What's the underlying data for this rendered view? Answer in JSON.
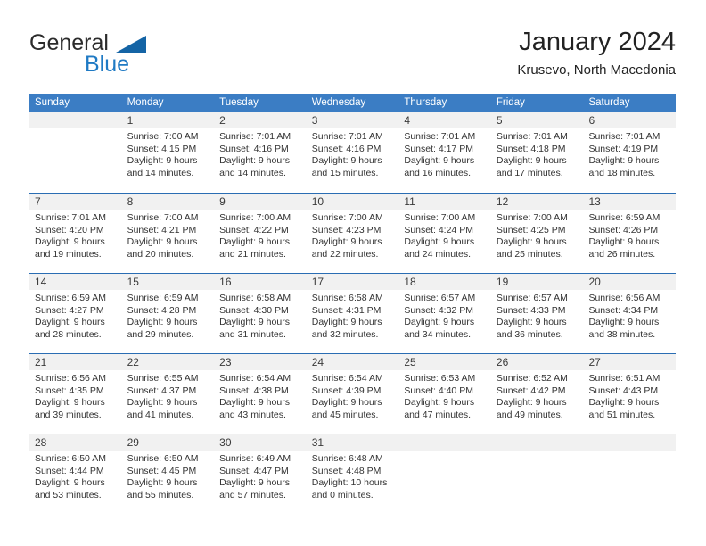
{
  "brand": {
    "name_part1": "General",
    "name_part2": "Blue",
    "triangle_icon": "triangle-icon",
    "color_dark": "#2b2b2b",
    "color_blue": "#1f7ac4"
  },
  "header": {
    "title": "January 2024",
    "subtitle": "Krusevo, North Macedonia"
  },
  "theme": {
    "header_bar_color": "#3b7dc4",
    "row_divider_color": "#2a6db3",
    "day_band_color": "#f1f1f1"
  },
  "weekdays": [
    "Sunday",
    "Monday",
    "Tuesday",
    "Wednesday",
    "Thursday",
    "Friday",
    "Saturday"
  ],
  "weeks": [
    [
      {
        "day": "",
        "sunrise": "",
        "sunset": "",
        "daylight_line1": "",
        "daylight_line2": ""
      },
      {
        "day": "1",
        "sunrise": "Sunrise: 7:00 AM",
        "sunset": "Sunset: 4:15 PM",
        "daylight_line1": "Daylight: 9 hours",
        "daylight_line2": "and 14 minutes."
      },
      {
        "day": "2",
        "sunrise": "Sunrise: 7:01 AM",
        "sunset": "Sunset: 4:16 PM",
        "daylight_line1": "Daylight: 9 hours",
        "daylight_line2": "and 14 minutes."
      },
      {
        "day": "3",
        "sunrise": "Sunrise: 7:01 AM",
        "sunset": "Sunset: 4:16 PM",
        "daylight_line1": "Daylight: 9 hours",
        "daylight_line2": "and 15 minutes."
      },
      {
        "day": "4",
        "sunrise": "Sunrise: 7:01 AM",
        "sunset": "Sunset: 4:17 PM",
        "daylight_line1": "Daylight: 9 hours",
        "daylight_line2": "and 16 minutes."
      },
      {
        "day": "5",
        "sunrise": "Sunrise: 7:01 AM",
        "sunset": "Sunset: 4:18 PM",
        "daylight_line1": "Daylight: 9 hours",
        "daylight_line2": "and 17 minutes."
      },
      {
        "day": "6",
        "sunrise": "Sunrise: 7:01 AM",
        "sunset": "Sunset: 4:19 PM",
        "daylight_line1": "Daylight: 9 hours",
        "daylight_line2": "and 18 minutes."
      }
    ],
    [
      {
        "day": "7",
        "sunrise": "Sunrise: 7:01 AM",
        "sunset": "Sunset: 4:20 PM",
        "daylight_line1": "Daylight: 9 hours",
        "daylight_line2": "and 19 minutes."
      },
      {
        "day": "8",
        "sunrise": "Sunrise: 7:00 AM",
        "sunset": "Sunset: 4:21 PM",
        "daylight_line1": "Daylight: 9 hours",
        "daylight_line2": "and 20 minutes."
      },
      {
        "day": "9",
        "sunrise": "Sunrise: 7:00 AM",
        "sunset": "Sunset: 4:22 PM",
        "daylight_line1": "Daylight: 9 hours",
        "daylight_line2": "and 21 minutes."
      },
      {
        "day": "10",
        "sunrise": "Sunrise: 7:00 AM",
        "sunset": "Sunset: 4:23 PM",
        "daylight_line1": "Daylight: 9 hours",
        "daylight_line2": "and 22 minutes."
      },
      {
        "day": "11",
        "sunrise": "Sunrise: 7:00 AM",
        "sunset": "Sunset: 4:24 PM",
        "daylight_line1": "Daylight: 9 hours",
        "daylight_line2": "and 24 minutes."
      },
      {
        "day": "12",
        "sunrise": "Sunrise: 7:00 AM",
        "sunset": "Sunset: 4:25 PM",
        "daylight_line1": "Daylight: 9 hours",
        "daylight_line2": "and 25 minutes."
      },
      {
        "day": "13",
        "sunrise": "Sunrise: 6:59 AM",
        "sunset": "Sunset: 4:26 PM",
        "daylight_line1": "Daylight: 9 hours",
        "daylight_line2": "and 26 minutes."
      }
    ],
    [
      {
        "day": "14",
        "sunrise": "Sunrise: 6:59 AM",
        "sunset": "Sunset: 4:27 PM",
        "daylight_line1": "Daylight: 9 hours",
        "daylight_line2": "and 28 minutes."
      },
      {
        "day": "15",
        "sunrise": "Sunrise: 6:59 AM",
        "sunset": "Sunset: 4:28 PM",
        "daylight_line1": "Daylight: 9 hours",
        "daylight_line2": "and 29 minutes."
      },
      {
        "day": "16",
        "sunrise": "Sunrise: 6:58 AM",
        "sunset": "Sunset: 4:30 PM",
        "daylight_line1": "Daylight: 9 hours",
        "daylight_line2": "and 31 minutes."
      },
      {
        "day": "17",
        "sunrise": "Sunrise: 6:58 AM",
        "sunset": "Sunset: 4:31 PM",
        "daylight_line1": "Daylight: 9 hours",
        "daylight_line2": "and 32 minutes."
      },
      {
        "day": "18",
        "sunrise": "Sunrise: 6:57 AM",
        "sunset": "Sunset: 4:32 PM",
        "daylight_line1": "Daylight: 9 hours",
        "daylight_line2": "and 34 minutes."
      },
      {
        "day": "19",
        "sunrise": "Sunrise: 6:57 AM",
        "sunset": "Sunset: 4:33 PM",
        "daylight_line1": "Daylight: 9 hours",
        "daylight_line2": "and 36 minutes."
      },
      {
        "day": "20",
        "sunrise": "Sunrise: 6:56 AM",
        "sunset": "Sunset: 4:34 PM",
        "daylight_line1": "Daylight: 9 hours",
        "daylight_line2": "and 38 minutes."
      }
    ],
    [
      {
        "day": "21",
        "sunrise": "Sunrise: 6:56 AM",
        "sunset": "Sunset: 4:35 PM",
        "daylight_line1": "Daylight: 9 hours",
        "daylight_line2": "and 39 minutes."
      },
      {
        "day": "22",
        "sunrise": "Sunrise: 6:55 AM",
        "sunset": "Sunset: 4:37 PM",
        "daylight_line1": "Daylight: 9 hours",
        "daylight_line2": "and 41 minutes."
      },
      {
        "day": "23",
        "sunrise": "Sunrise: 6:54 AM",
        "sunset": "Sunset: 4:38 PM",
        "daylight_line1": "Daylight: 9 hours",
        "daylight_line2": "and 43 minutes."
      },
      {
        "day": "24",
        "sunrise": "Sunrise: 6:54 AM",
        "sunset": "Sunset: 4:39 PM",
        "daylight_line1": "Daylight: 9 hours",
        "daylight_line2": "and 45 minutes."
      },
      {
        "day": "25",
        "sunrise": "Sunrise: 6:53 AM",
        "sunset": "Sunset: 4:40 PM",
        "daylight_line1": "Daylight: 9 hours",
        "daylight_line2": "and 47 minutes."
      },
      {
        "day": "26",
        "sunrise": "Sunrise: 6:52 AM",
        "sunset": "Sunset: 4:42 PM",
        "daylight_line1": "Daylight: 9 hours",
        "daylight_line2": "and 49 minutes."
      },
      {
        "day": "27",
        "sunrise": "Sunrise: 6:51 AM",
        "sunset": "Sunset: 4:43 PM",
        "daylight_line1": "Daylight: 9 hours",
        "daylight_line2": "and 51 minutes."
      }
    ],
    [
      {
        "day": "28",
        "sunrise": "Sunrise: 6:50 AM",
        "sunset": "Sunset: 4:44 PM",
        "daylight_line1": "Daylight: 9 hours",
        "daylight_line2": "and 53 minutes."
      },
      {
        "day": "29",
        "sunrise": "Sunrise: 6:50 AM",
        "sunset": "Sunset: 4:45 PM",
        "daylight_line1": "Daylight: 9 hours",
        "daylight_line2": "and 55 minutes."
      },
      {
        "day": "30",
        "sunrise": "Sunrise: 6:49 AM",
        "sunset": "Sunset: 4:47 PM",
        "daylight_line1": "Daylight: 9 hours",
        "daylight_line2": "and 57 minutes."
      },
      {
        "day": "31",
        "sunrise": "Sunrise: 6:48 AM",
        "sunset": "Sunset: 4:48 PM",
        "daylight_line1": "Daylight: 10 hours",
        "daylight_line2": "and 0 minutes."
      },
      {
        "day": "",
        "sunrise": "",
        "sunset": "",
        "daylight_line1": "",
        "daylight_line2": ""
      },
      {
        "day": "",
        "sunrise": "",
        "sunset": "",
        "daylight_line1": "",
        "daylight_line2": ""
      },
      {
        "day": "",
        "sunrise": "",
        "sunset": "",
        "daylight_line1": "",
        "daylight_line2": ""
      }
    ]
  ]
}
